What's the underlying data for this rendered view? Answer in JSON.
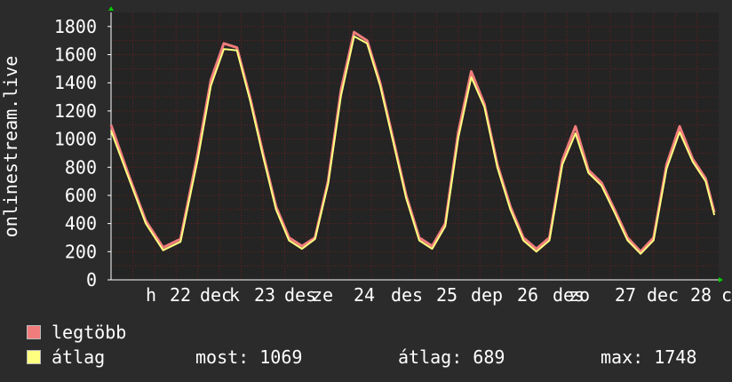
{
  "chart_data": {
    "type": "line",
    "ylabel": "onlinestream.live",
    "ylim": [
      0,
      1900
    ],
    "y_ticks": [
      "0",
      "200",
      "400",
      "600",
      "800",
      "1000",
      "1200",
      "1400",
      "1600",
      "1800"
    ],
    "x_ticks": [
      "h",
      "22",
      "dec",
      "k",
      "23",
      "des",
      "ze",
      "24",
      "des",
      "25",
      "dep",
      "26",
      "des",
      "zo",
      "27",
      "dec",
      "28",
      "c"
    ],
    "grid": true,
    "colors": {
      "legtobb": "#f07c7c",
      "atlag": "#ffff80",
      "background": "#2b2b2b",
      "plot": "#242424",
      "grid": "#6b1f1f"
    },
    "series": [
      {
        "name": "legtöbb",
        "x": [
          0.0,
          0.2,
          0.4,
          0.6,
          0.8,
          1.0,
          1.15,
          1.3,
          1.45,
          1.6,
          1.75,
          1.9,
          2.05,
          2.2,
          2.35,
          2.5,
          2.65,
          2.8,
          2.95,
          3.1,
          3.25,
          3.4,
          3.55,
          3.7,
          3.85,
          4.0,
          4.15,
          4.3,
          4.45,
          4.6,
          4.75,
          4.9,
          5.05,
          5.2,
          5.35,
          5.5,
          5.65,
          5.8,
          5.95,
          6.1,
          6.25,
          6.4,
          6.55,
          6.7,
          6.85,
          6.95
        ],
        "values": [
          1100,
          750,
          420,
          230,
          290,
          900,
          1420,
          1680,
          1650,
          1300,
          900,
          520,
          300,
          240,
          300,
          700,
          1350,
          1760,
          1700,
          1400,
          1000,
          600,
          300,
          240,
          400,
          1050,
          1480,
          1250,
          820,
          520,
          300,
          220,
          300,
          850,
          1090,
          780,
          690,
          500,
          300,
          200,
          300,
          820,
          1090,
          860,
          720,
          480
        ]
      },
      {
        "name": "átlag",
        "x": [
          0.0,
          0.2,
          0.4,
          0.6,
          0.8,
          1.0,
          1.15,
          1.3,
          1.45,
          1.6,
          1.75,
          1.9,
          2.05,
          2.2,
          2.35,
          2.5,
          2.65,
          2.8,
          2.95,
          3.1,
          3.25,
          3.4,
          3.55,
          3.7,
          3.85,
          4.0,
          4.15,
          4.3,
          4.45,
          4.6,
          4.75,
          4.9,
          5.05,
          5.2,
          5.35,
          5.5,
          5.65,
          5.8,
          5.95,
          6.1,
          6.25,
          6.4,
          6.55,
          6.7,
          6.85,
          6.95
        ],
        "values": [
          1060,
          730,
          400,
          210,
          270,
          860,
          1380,
          1640,
          1630,
          1280,
          880,
          500,
          280,
          220,
          290,
          680,
          1310,
          1730,
          1680,
          1380,
          980,
          580,
          280,
          220,
          380,
          1010,
          1440,
          1230,
          800,
          500,
          280,
          200,
          280,
          820,
          1040,
          760,
          670,
          480,
          280,
          185,
          280,
          790,
          1050,
          840,
          700,
          460
        ]
      }
    ]
  },
  "legend": [
    {
      "label": "legtöbb",
      "color": "#f07c7c"
    },
    {
      "label": "átlag",
      "color": "#ffff80"
    }
  ],
  "stats": {
    "most": "most: 1069",
    "atlag": "átlag: 689",
    "max": "max: 1748"
  }
}
